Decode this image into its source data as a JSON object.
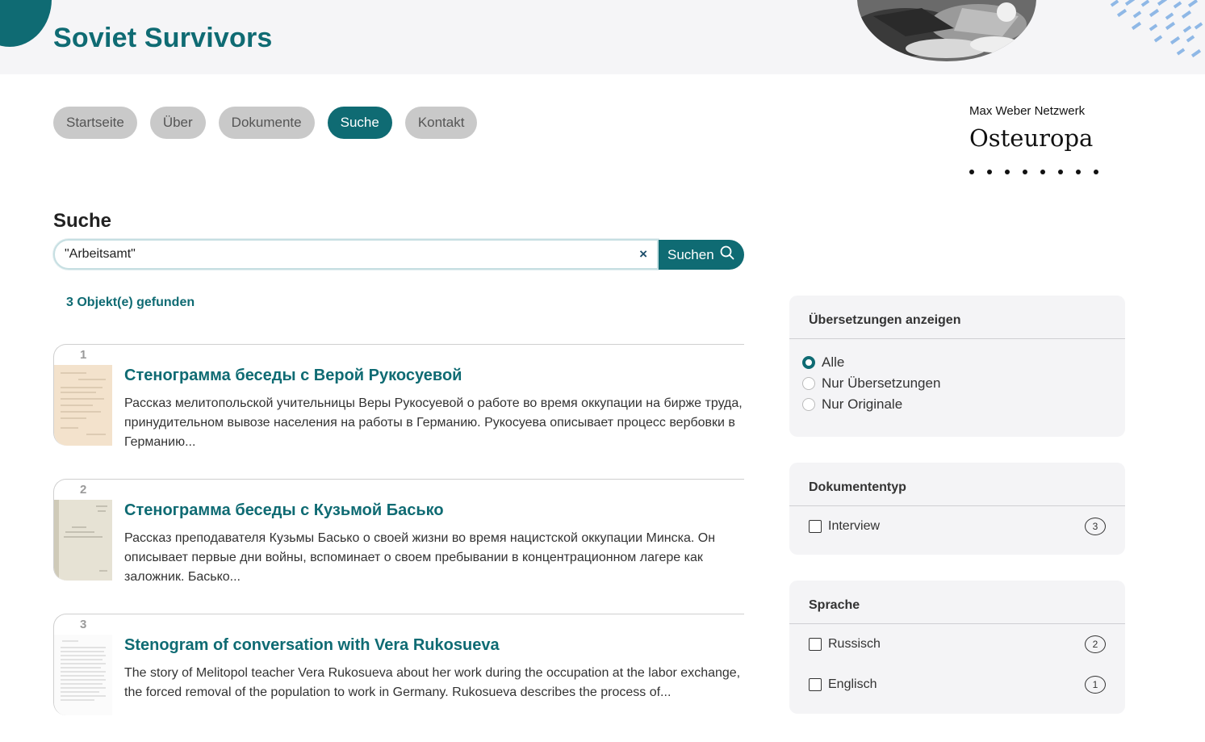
{
  "header": {
    "site_title": "Soviet Survivors"
  },
  "nav": {
    "items": [
      {
        "label": "Startseite",
        "active": false
      },
      {
        "label": "Über",
        "active": false
      },
      {
        "label": "Dokumente",
        "active": false
      },
      {
        "label": "Suche",
        "active": true
      },
      {
        "label": "Kontakt",
        "active": false
      }
    ]
  },
  "logo": {
    "top_line": "Max Weber Netzwerk",
    "main": "Osteuropa"
  },
  "search": {
    "heading": "Suche",
    "query": "\"Arbeitsamt\"",
    "clear_icon": "×",
    "button_label": "Suchen",
    "result_count": "3 Objekt(e) gefunden"
  },
  "results": [
    {
      "number": "1",
      "title": "Стенограмма беседы с Верой Рукосуевой",
      "description": "Рассказ мелитопольской учительницы Веры Рукосуевой о работе во время оккупации на бирже труда, принудительном вывозе населения на работы в Германию. Рукосуева описывает процесс вербовки в Германию..."
    },
    {
      "number": "2",
      "title": "Стенограмма беседы с Кузьмой Басько",
      "description": "Рассказ преподавателя Кузьмы Басько о своей жизни во время нацистской оккупации Минска. Он описывает первые дни войны, вспоминает о своем пребывании в концентрационном лагере как заложник. Басько..."
    },
    {
      "number": "3",
      "title": "Stenogram of conversation with Vera Rukosueva",
      "description": "The story of Melitopol teacher Vera Rukosueva about her work during the occupation at the labor exchange, the forced removal of the population to work in Germany. Rukosueva describes the process of..."
    }
  ],
  "facets": {
    "translations": {
      "title": "Übersetzungen anzeigen",
      "options": [
        {
          "label": "Alle",
          "checked": true
        },
        {
          "label": "Nur Übersetzungen",
          "checked": false
        },
        {
          "label": "Nur Originale",
          "checked": false
        }
      ]
    },
    "doctype": {
      "title": "Dokumententyp",
      "options": [
        {
          "label": "Interview",
          "count": "3"
        }
      ]
    },
    "language": {
      "title": "Sprache",
      "options": [
        {
          "label": "Russisch",
          "count": "2"
        },
        {
          "label": "Englisch",
          "count": "1"
        }
      ]
    }
  },
  "colors": {
    "accent": "#0f6b73",
    "pill_inactive": "#c9c9c9",
    "panel_bg": "#f4f4f6",
    "header_bg": "#f5f5f7",
    "pattern_blue": "#8fb8e6"
  }
}
